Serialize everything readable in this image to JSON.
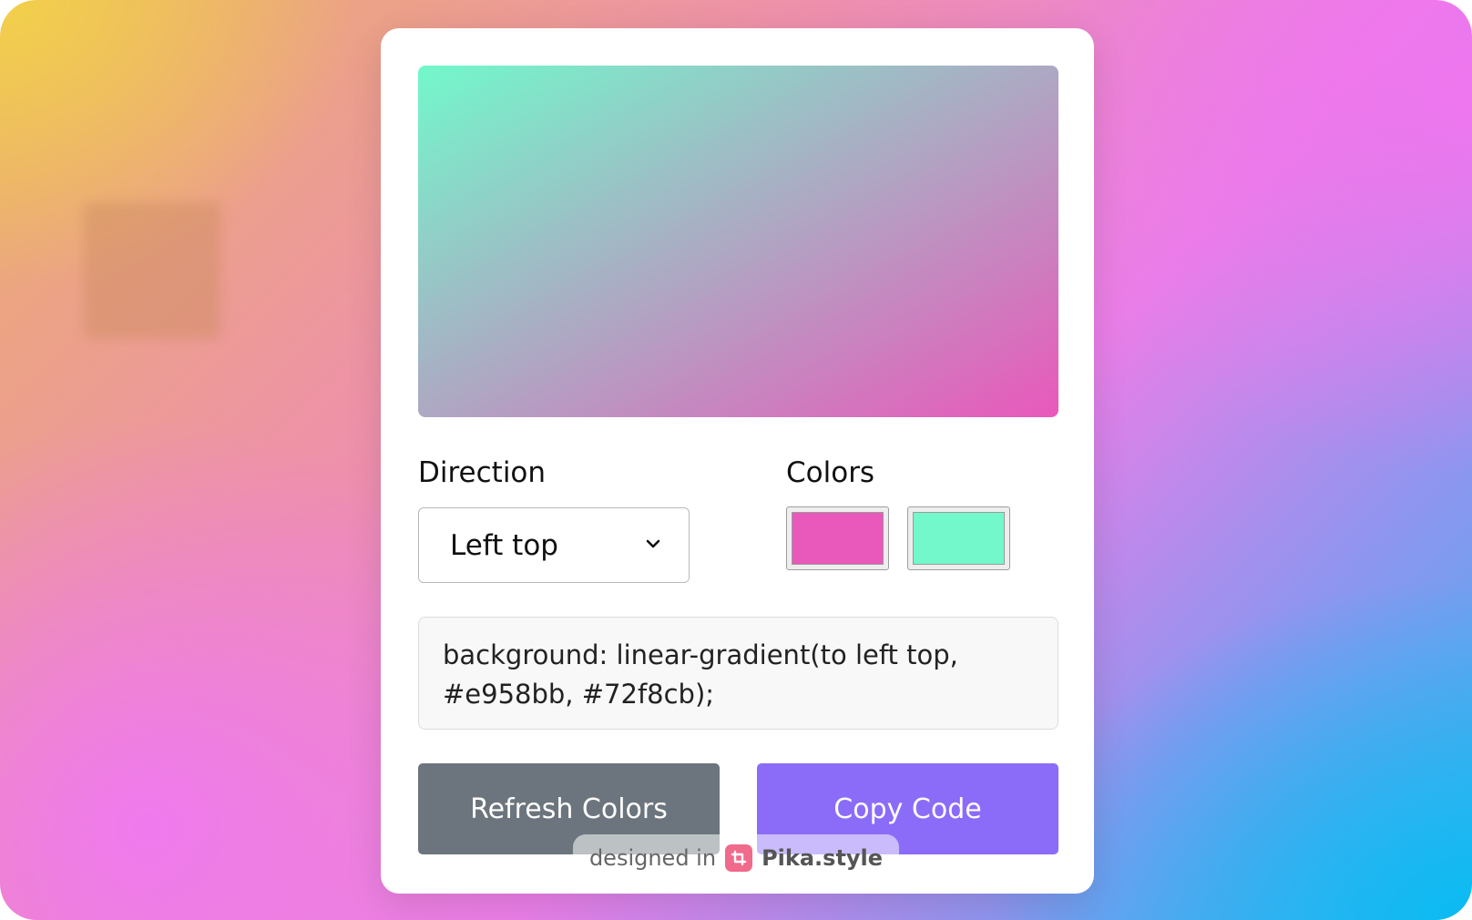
{
  "preview": {
    "color_start": "#e958bb",
    "color_end": "#72f8cb",
    "direction": "to left top"
  },
  "direction": {
    "label": "Direction",
    "selected": "Left top"
  },
  "colors": {
    "label": "Colors",
    "swatches": [
      "#e958bb",
      "#72f8cb"
    ]
  },
  "code": {
    "line1": "background: linear-gradient(to left top,",
    "line2": "#e958bb, #72f8cb);"
  },
  "buttons": {
    "refresh": "Refresh Colors",
    "copy": "Copy Code"
  },
  "watermark": {
    "prefix": "designed in",
    "brand": "Pika.style"
  },
  "theme": {
    "refresh_button": "#6c757d",
    "copy_button": "#8b6cf8"
  }
}
